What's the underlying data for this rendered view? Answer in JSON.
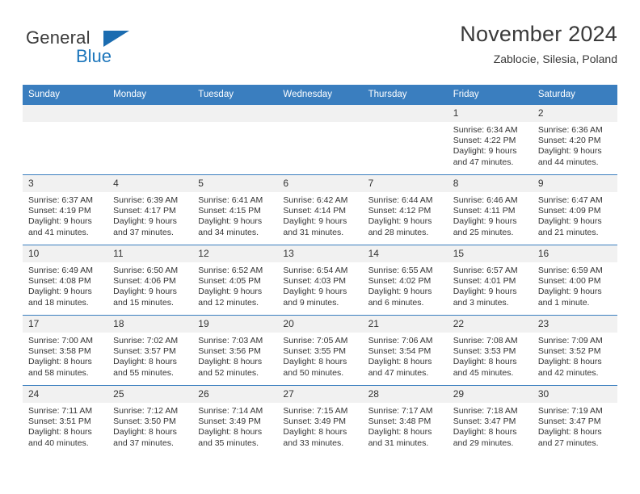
{
  "brand": {
    "name_part1": "General",
    "name_part2": "Blue"
  },
  "header": {
    "title": "November 2024",
    "subtitle": "Zablocie, Silesia, Poland"
  },
  "colors": {
    "header_blue": "#3a7ebf",
    "brand_blue": "#1b75bb",
    "daynum_bg": "#f1f1f1",
    "text": "#333333"
  },
  "weekday_headers": [
    "Sunday",
    "Monday",
    "Tuesday",
    "Wednesday",
    "Thursday",
    "Friday",
    "Saturday"
  ],
  "weeks": [
    [
      {
        "day": "",
        "empty": true
      },
      {
        "day": "",
        "empty": true
      },
      {
        "day": "",
        "empty": true
      },
      {
        "day": "",
        "empty": true
      },
      {
        "day": "",
        "empty": true
      },
      {
        "day": "1",
        "sunrise": "Sunrise: 6:34 AM",
        "sunset": "Sunset: 4:22 PM",
        "daylight1": "Daylight: 9 hours",
        "daylight2": "and 47 minutes."
      },
      {
        "day": "2",
        "sunrise": "Sunrise: 6:36 AM",
        "sunset": "Sunset: 4:20 PM",
        "daylight1": "Daylight: 9 hours",
        "daylight2": "and 44 minutes."
      }
    ],
    [
      {
        "day": "3",
        "sunrise": "Sunrise: 6:37 AM",
        "sunset": "Sunset: 4:19 PM",
        "daylight1": "Daylight: 9 hours",
        "daylight2": "and 41 minutes."
      },
      {
        "day": "4",
        "sunrise": "Sunrise: 6:39 AM",
        "sunset": "Sunset: 4:17 PM",
        "daylight1": "Daylight: 9 hours",
        "daylight2": "and 37 minutes."
      },
      {
        "day": "5",
        "sunrise": "Sunrise: 6:41 AM",
        "sunset": "Sunset: 4:15 PM",
        "daylight1": "Daylight: 9 hours",
        "daylight2": "and 34 minutes."
      },
      {
        "day": "6",
        "sunrise": "Sunrise: 6:42 AM",
        "sunset": "Sunset: 4:14 PM",
        "daylight1": "Daylight: 9 hours",
        "daylight2": "and 31 minutes."
      },
      {
        "day": "7",
        "sunrise": "Sunrise: 6:44 AM",
        "sunset": "Sunset: 4:12 PM",
        "daylight1": "Daylight: 9 hours",
        "daylight2": "and 28 minutes."
      },
      {
        "day": "8",
        "sunrise": "Sunrise: 6:46 AM",
        "sunset": "Sunset: 4:11 PM",
        "daylight1": "Daylight: 9 hours",
        "daylight2": "and 25 minutes."
      },
      {
        "day": "9",
        "sunrise": "Sunrise: 6:47 AM",
        "sunset": "Sunset: 4:09 PM",
        "daylight1": "Daylight: 9 hours",
        "daylight2": "and 21 minutes."
      }
    ],
    [
      {
        "day": "10",
        "sunrise": "Sunrise: 6:49 AM",
        "sunset": "Sunset: 4:08 PM",
        "daylight1": "Daylight: 9 hours",
        "daylight2": "and 18 minutes."
      },
      {
        "day": "11",
        "sunrise": "Sunrise: 6:50 AM",
        "sunset": "Sunset: 4:06 PM",
        "daylight1": "Daylight: 9 hours",
        "daylight2": "and 15 minutes."
      },
      {
        "day": "12",
        "sunrise": "Sunrise: 6:52 AM",
        "sunset": "Sunset: 4:05 PM",
        "daylight1": "Daylight: 9 hours",
        "daylight2": "and 12 minutes."
      },
      {
        "day": "13",
        "sunrise": "Sunrise: 6:54 AM",
        "sunset": "Sunset: 4:03 PM",
        "daylight1": "Daylight: 9 hours",
        "daylight2": "and 9 minutes."
      },
      {
        "day": "14",
        "sunrise": "Sunrise: 6:55 AM",
        "sunset": "Sunset: 4:02 PM",
        "daylight1": "Daylight: 9 hours",
        "daylight2": "and 6 minutes."
      },
      {
        "day": "15",
        "sunrise": "Sunrise: 6:57 AM",
        "sunset": "Sunset: 4:01 PM",
        "daylight1": "Daylight: 9 hours",
        "daylight2": "and 3 minutes."
      },
      {
        "day": "16",
        "sunrise": "Sunrise: 6:59 AM",
        "sunset": "Sunset: 4:00 PM",
        "daylight1": "Daylight: 9 hours",
        "daylight2": "and 1 minute."
      }
    ],
    [
      {
        "day": "17",
        "sunrise": "Sunrise: 7:00 AM",
        "sunset": "Sunset: 3:58 PM",
        "daylight1": "Daylight: 8 hours",
        "daylight2": "and 58 minutes."
      },
      {
        "day": "18",
        "sunrise": "Sunrise: 7:02 AM",
        "sunset": "Sunset: 3:57 PM",
        "daylight1": "Daylight: 8 hours",
        "daylight2": "and 55 minutes."
      },
      {
        "day": "19",
        "sunrise": "Sunrise: 7:03 AM",
        "sunset": "Sunset: 3:56 PM",
        "daylight1": "Daylight: 8 hours",
        "daylight2": "and 52 minutes."
      },
      {
        "day": "20",
        "sunrise": "Sunrise: 7:05 AM",
        "sunset": "Sunset: 3:55 PM",
        "daylight1": "Daylight: 8 hours",
        "daylight2": "and 50 minutes."
      },
      {
        "day": "21",
        "sunrise": "Sunrise: 7:06 AM",
        "sunset": "Sunset: 3:54 PM",
        "daylight1": "Daylight: 8 hours",
        "daylight2": "and 47 minutes."
      },
      {
        "day": "22",
        "sunrise": "Sunrise: 7:08 AM",
        "sunset": "Sunset: 3:53 PM",
        "daylight1": "Daylight: 8 hours",
        "daylight2": "and 45 minutes."
      },
      {
        "day": "23",
        "sunrise": "Sunrise: 7:09 AM",
        "sunset": "Sunset: 3:52 PM",
        "daylight1": "Daylight: 8 hours",
        "daylight2": "and 42 minutes."
      }
    ],
    [
      {
        "day": "24",
        "sunrise": "Sunrise: 7:11 AM",
        "sunset": "Sunset: 3:51 PM",
        "daylight1": "Daylight: 8 hours",
        "daylight2": "and 40 minutes."
      },
      {
        "day": "25",
        "sunrise": "Sunrise: 7:12 AM",
        "sunset": "Sunset: 3:50 PM",
        "daylight1": "Daylight: 8 hours",
        "daylight2": "and 37 minutes."
      },
      {
        "day": "26",
        "sunrise": "Sunrise: 7:14 AM",
        "sunset": "Sunset: 3:49 PM",
        "daylight1": "Daylight: 8 hours",
        "daylight2": "and 35 minutes."
      },
      {
        "day": "27",
        "sunrise": "Sunrise: 7:15 AM",
        "sunset": "Sunset: 3:49 PM",
        "daylight1": "Daylight: 8 hours",
        "daylight2": "and 33 minutes."
      },
      {
        "day": "28",
        "sunrise": "Sunrise: 7:17 AM",
        "sunset": "Sunset: 3:48 PM",
        "daylight1": "Daylight: 8 hours",
        "daylight2": "and 31 minutes."
      },
      {
        "day": "29",
        "sunrise": "Sunrise: 7:18 AM",
        "sunset": "Sunset: 3:47 PM",
        "daylight1": "Daylight: 8 hours",
        "daylight2": "and 29 minutes."
      },
      {
        "day": "30",
        "sunrise": "Sunrise: 7:19 AM",
        "sunset": "Sunset: 3:47 PM",
        "daylight1": "Daylight: 8 hours",
        "daylight2": "and 27 minutes."
      }
    ]
  ]
}
